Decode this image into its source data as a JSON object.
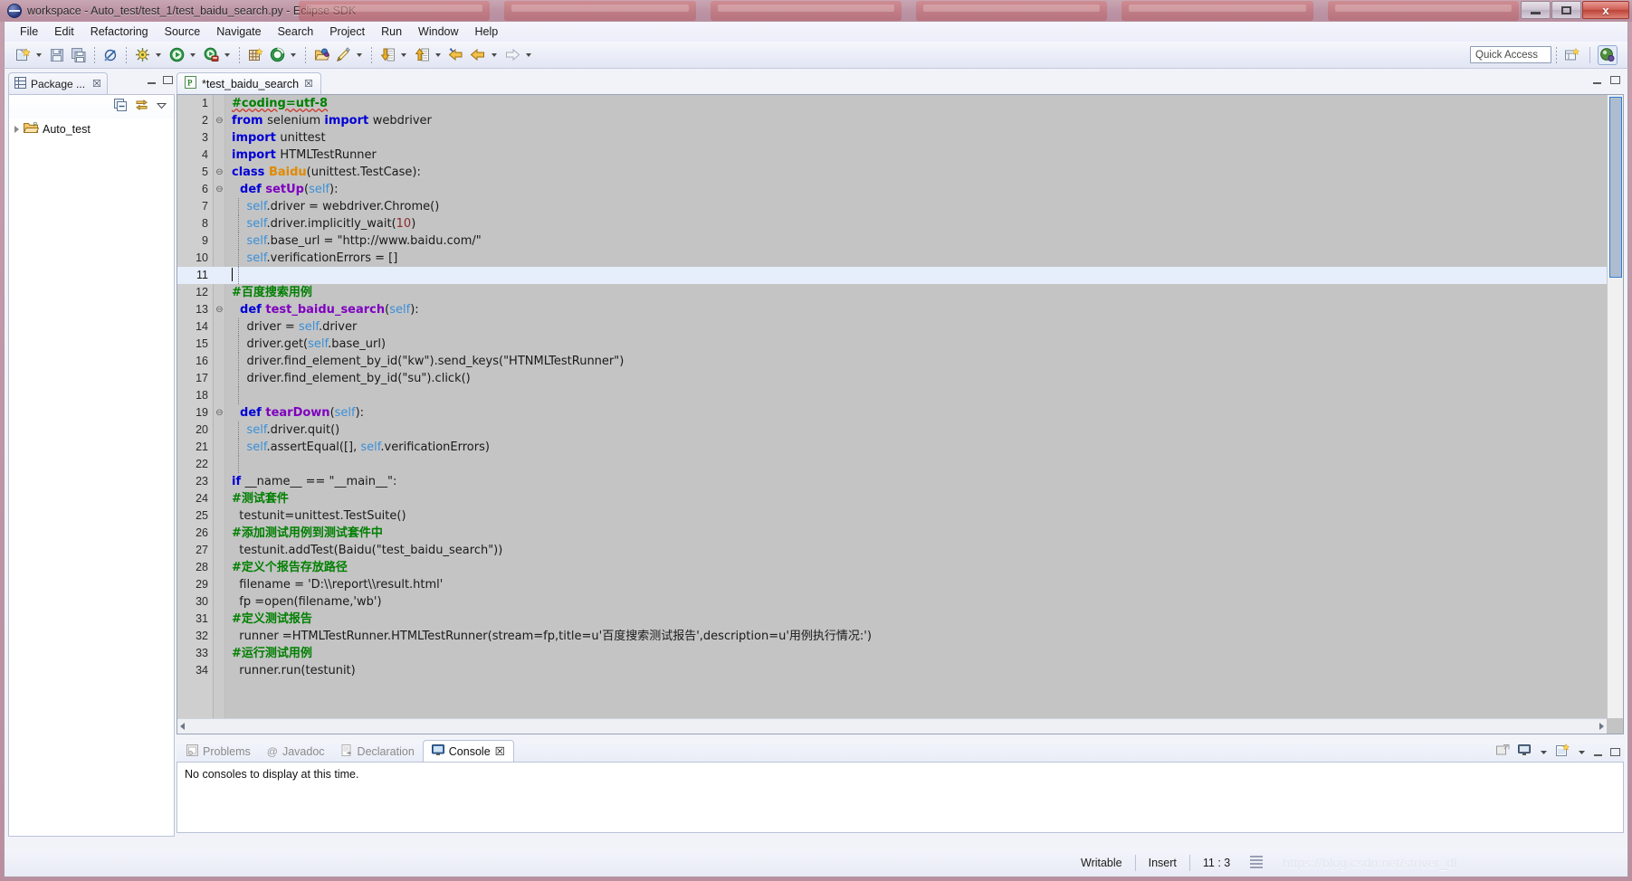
{
  "window": {
    "title": "workspace - Auto_test/test_1/test_baidu_search.py - Eclipse SDK",
    "app_icon": "eclipse-icon",
    "minimize_label": "",
    "maximize_label": "",
    "close_label": "x"
  },
  "menubar": {
    "items": [
      {
        "label": "File"
      },
      {
        "label": "Edit"
      },
      {
        "label": "Refactoring"
      },
      {
        "label": "Source"
      },
      {
        "label": "Navigate"
      },
      {
        "label": "Search"
      },
      {
        "label": "Project"
      },
      {
        "label": "Run"
      },
      {
        "label": "Window"
      },
      {
        "label": "Help"
      }
    ]
  },
  "toolbar": {
    "buttons": [
      {
        "name": "new-wizard-icon",
        "glyph": "🗎",
        "dropdown": true
      },
      {
        "name": "save-icon",
        "glyph": "💾",
        "dropdown": false
      },
      {
        "name": "save-all-icon",
        "glyph": "🖫",
        "dropdown": false
      },
      {
        "name": "toggle-annotation-icon",
        "glyph": "⊘",
        "dropdown": false
      },
      {
        "name": "debug-icon",
        "glyph": "☀",
        "dropdown": true
      },
      {
        "name": "run-icon",
        "glyph": "▶",
        "dropdown": true
      },
      {
        "name": "external-tools-icon",
        "glyph": "▶",
        "dropdown": true
      },
      {
        "name": "new-pydev-project-icon",
        "glyph": "⊞",
        "dropdown": false
      },
      {
        "name": "pydev-package-icon",
        "glyph": "◉",
        "dropdown": true
      },
      {
        "name": "open-type-icon",
        "glyph": "📂",
        "dropdown": false
      },
      {
        "name": "search-icon",
        "glyph": "✎",
        "dropdown": true
      },
      {
        "name": "next-annotation-icon",
        "glyph": "⬇",
        "dropdown": true
      },
      {
        "name": "previous-annotation-icon",
        "glyph": "⬆",
        "dropdown": true
      },
      {
        "name": "back-to-icon",
        "glyph": "⇦",
        "dropdown": false
      },
      {
        "name": "back-icon",
        "glyph": "⇦",
        "dropdown": true
      },
      {
        "name": "forward-icon",
        "glyph": "⇨",
        "dropdown": true
      }
    ],
    "quick_access_placeholder": "Quick Access",
    "open_perspective_icon": "open-perspective-icon",
    "pydev_perspective_icon": "pydev-perspective-icon"
  },
  "package_explorer": {
    "tab_label": "Package ...",
    "tab_icon": "package-explorer-icon",
    "close_glyph": "☒",
    "minimize_glyph": "−",
    "maximize_glyph": "□",
    "view_menu_glyph": "▽",
    "collapse_all_icon": "collapse-all-icon",
    "link-with-editor-icon": "link-with-editor-icon",
    "tree": [
      {
        "label": "Auto_test",
        "icon": "project-folder-icon",
        "expandable": true,
        "expanded": false
      }
    ]
  },
  "editor": {
    "tab_label": "*test_baidu_search",
    "tab_icon": "python-file-icon",
    "close_glyph": "☒",
    "minimize_glyph": "−",
    "maximize_glyph": "□",
    "current_line": 11,
    "lines": [
      {
        "n": 1,
        "fold": "",
        "segs": [
          {
            "t": "#coding=utf-8",
            "c": "cmt",
            "sq": true
          }
        ]
      },
      {
        "n": 2,
        "fold": "⊖",
        "segs": [
          {
            "t": "from ",
            "c": "kw"
          },
          {
            "t": "selenium ",
            "c": "plain"
          },
          {
            "t": "import ",
            "c": "kw"
          },
          {
            "t": "webdriver",
            "c": "plain"
          }
        ]
      },
      {
        "n": 3,
        "fold": "",
        "segs": [
          {
            "t": "import ",
            "c": "kw"
          },
          {
            "t": "unittest",
            "c": "plain"
          }
        ]
      },
      {
        "n": 4,
        "fold": "",
        "segs": [
          {
            "t": "import ",
            "c": "kw"
          },
          {
            "t": "HTMLTestRunner",
            "c": "plain"
          }
        ]
      },
      {
        "n": 5,
        "fold": "⊖",
        "segs": [
          {
            "t": "class ",
            "c": "kw"
          },
          {
            "t": "Baidu",
            "c": "cls"
          },
          {
            "t": "(unittest.TestCase):",
            "c": "plain"
          }
        ]
      },
      {
        "n": 6,
        "fold": "⊖",
        "segs": [
          {
            "t": "  def ",
            "c": "kw"
          },
          {
            "t": "setUp",
            "c": "kw2"
          },
          {
            "t": "(",
            "c": "plain"
          },
          {
            "t": "self",
            "c": "self"
          },
          {
            "t": "):",
            "c": "plain"
          }
        ]
      },
      {
        "n": 7,
        "fold": "",
        "segs": [
          {
            "t": "    ",
            "c": "plain"
          },
          {
            "t": "self",
            "c": "self"
          },
          {
            "t": ".driver = webdriver.Chrome()",
            "c": "plain"
          }
        ]
      },
      {
        "n": 8,
        "fold": "",
        "segs": [
          {
            "t": "    ",
            "c": "plain"
          },
          {
            "t": "self",
            "c": "self"
          },
          {
            "t": ".driver.implicitly_wait(",
            "c": "plain"
          },
          {
            "t": "10",
            "c": "num-lit"
          },
          {
            "t": ")",
            "c": "plain"
          }
        ]
      },
      {
        "n": 9,
        "fold": "",
        "segs": [
          {
            "t": "    ",
            "c": "plain"
          },
          {
            "t": "self",
            "c": "self"
          },
          {
            "t": ".base_url = \"http://www.baidu.com/\"",
            "c": "plain"
          }
        ]
      },
      {
        "n": 10,
        "fold": "",
        "segs": [
          {
            "t": "    ",
            "c": "plain"
          },
          {
            "t": "self",
            "c": "self"
          },
          {
            "t": ".verificationErrors = []",
            "c": "plain"
          }
        ]
      },
      {
        "n": 11,
        "fold": "",
        "segs": [],
        "current": true,
        "caret": true
      },
      {
        "n": 12,
        "fold": "",
        "segs": [
          {
            "t": "#百度搜索用例",
            "c": "cmt"
          }
        ]
      },
      {
        "n": 13,
        "fold": "⊖",
        "segs": [
          {
            "t": "  def ",
            "c": "kw"
          },
          {
            "t": "test_baidu_search",
            "c": "kw2"
          },
          {
            "t": "(",
            "c": "plain"
          },
          {
            "t": "self",
            "c": "self"
          },
          {
            "t": "):",
            "c": "plain"
          }
        ]
      },
      {
        "n": 14,
        "fold": "",
        "segs": [
          {
            "t": "    driver = ",
            "c": "plain"
          },
          {
            "t": "self",
            "c": "self"
          },
          {
            "t": ".driver",
            "c": "plain"
          }
        ]
      },
      {
        "n": 15,
        "fold": "",
        "segs": [
          {
            "t": "    driver.get(",
            "c": "plain"
          },
          {
            "t": "self",
            "c": "self"
          },
          {
            "t": ".base_url)",
            "c": "plain"
          }
        ]
      },
      {
        "n": 16,
        "fold": "",
        "segs": [
          {
            "t": "    driver.find_element_by_id(\"kw\").send_keys(\"HTNMLTestRunner\")",
            "c": "plain"
          }
        ]
      },
      {
        "n": 17,
        "fold": "",
        "segs": [
          {
            "t": "    driver.find_element_by_id(\"su\").click()",
            "c": "plain"
          }
        ]
      },
      {
        "n": 18,
        "fold": "",
        "segs": []
      },
      {
        "n": 19,
        "fold": "⊖",
        "segs": [
          {
            "t": "  def ",
            "c": "kw"
          },
          {
            "t": "tearDown",
            "c": "kw2"
          },
          {
            "t": "(",
            "c": "plain"
          },
          {
            "t": "self",
            "c": "self"
          },
          {
            "t": "):",
            "c": "plain"
          }
        ]
      },
      {
        "n": 20,
        "fold": "",
        "segs": [
          {
            "t": "    ",
            "c": "plain"
          },
          {
            "t": "self",
            "c": "self"
          },
          {
            "t": ".driver.quit()",
            "c": "plain"
          }
        ]
      },
      {
        "n": 21,
        "fold": "",
        "segs": [
          {
            "t": "    ",
            "c": "plain"
          },
          {
            "t": "self",
            "c": "self"
          },
          {
            "t": ".assertEqual([], ",
            "c": "plain"
          },
          {
            "t": "self",
            "c": "self"
          },
          {
            "t": ".verificationErrors)",
            "c": "plain"
          }
        ]
      },
      {
        "n": 22,
        "fold": "",
        "segs": []
      },
      {
        "n": 23,
        "fold": "",
        "segs": [
          {
            "t": "if ",
            "c": "kw"
          },
          {
            "t": "__name__ == \"__main__\":",
            "c": "plain"
          }
        ]
      },
      {
        "n": 24,
        "fold": "",
        "segs": [
          {
            "t": "#测试套件",
            "c": "cmt"
          }
        ]
      },
      {
        "n": 25,
        "fold": "",
        "segs": [
          {
            "t": "  testunit=unittest.TestSuite()",
            "c": "plain"
          }
        ]
      },
      {
        "n": 26,
        "fold": "",
        "segs": [
          {
            "t": "#添加测试用例到测试套件中",
            "c": "cmt"
          }
        ]
      },
      {
        "n": 27,
        "fold": "",
        "segs": [
          {
            "t": "  testunit.addTest(Baidu(\"test_baidu_search\"))",
            "c": "plain"
          }
        ]
      },
      {
        "n": 28,
        "fold": "",
        "segs": [
          {
            "t": "#定义个报告存放路径",
            "c": "cmt"
          }
        ]
      },
      {
        "n": 29,
        "fold": "",
        "segs": [
          {
            "t": "  filename = 'D:\\\\report\\\\result.html'",
            "c": "plain"
          }
        ]
      },
      {
        "n": 30,
        "fold": "",
        "segs": [
          {
            "t": "  fp =open(filename,'wb')",
            "c": "plain"
          }
        ]
      },
      {
        "n": 31,
        "fold": "",
        "segs": [
          {
            "t": "#定义测试报告",
            "c": "cmt"
          }
        ]
      },
      {
        "n": 32,
        "fold": "",
        "segs": [
          {
            "t": "  runner =HTMLTestRunner.HTMLTestRunner(stream=fp,title=u'百度搜索测试报告',description=u'用例执行情况:')",
            "c": "plain"
          }
        ]
      },
      {
        "n": 33,
        "fold": "",
        "segs": [
          {
            "t": "#运行测试用例",
            "c": "cmt"
          }
        ]
      },
      {
        "n": 34,
        "fold": "",
        "segs": [
          {
            "t": "  runner.run(testunit)",
            "c": "plain"
          }
        ]
      }
    ]
  },
  "console": {
    "tabs": [
      {
        "label": "Problems",
        "icon": "problems-icon",
        "active": false
      },
      {
        "label": "Javadoc",
        "icon": "javadoc-icon",
        "active": false
      },
      {
        "label": "Declaration",
        "icon": "declaration-icon",
        "active": false
      },
      {
        "label": "Console",
        "icon": "console-icon",
        "active": true,
        "close_glyph": "☒"
      }
    ],
    "message": "No consoles to display at this time.",
    "header_buttons": [
      {
        "name": "open-console-icon",
        "glyph": "❑"
      },
      {
        "name": "display-selected-console-icon",
        "glyph": "🖥",
        "dropdown": true
      },
      {
        "name": "new-console-view-icon",
        "glyph": "🗒",
        "dropdown": true
      },
      {
        "name": "minimize-icon",
        "glyph": "−"
      },
      {
        "name": "maximize-icon",
        "glyph": "□"
      }
    ]
  },
  "statusbar": {
    "writable": "Writable",
    "insert": "Insert",
    "position": "11 : 3",
    "watermark": "https://blog.csdn.net/striver_dl"
  },
  "colors": {
    "keyword": "#0000d6",
    "function": "#7f00bf",
    "class": "#e08a00",
    "self": "#3a8fd8",
    "comment": "#008000",
    "number": "#8b2b2b",
    "editor_bg": "#c4c4c4",
    "current_line": "#e6eefb",
    "title_bar": "#bb93a3"
  }
}
